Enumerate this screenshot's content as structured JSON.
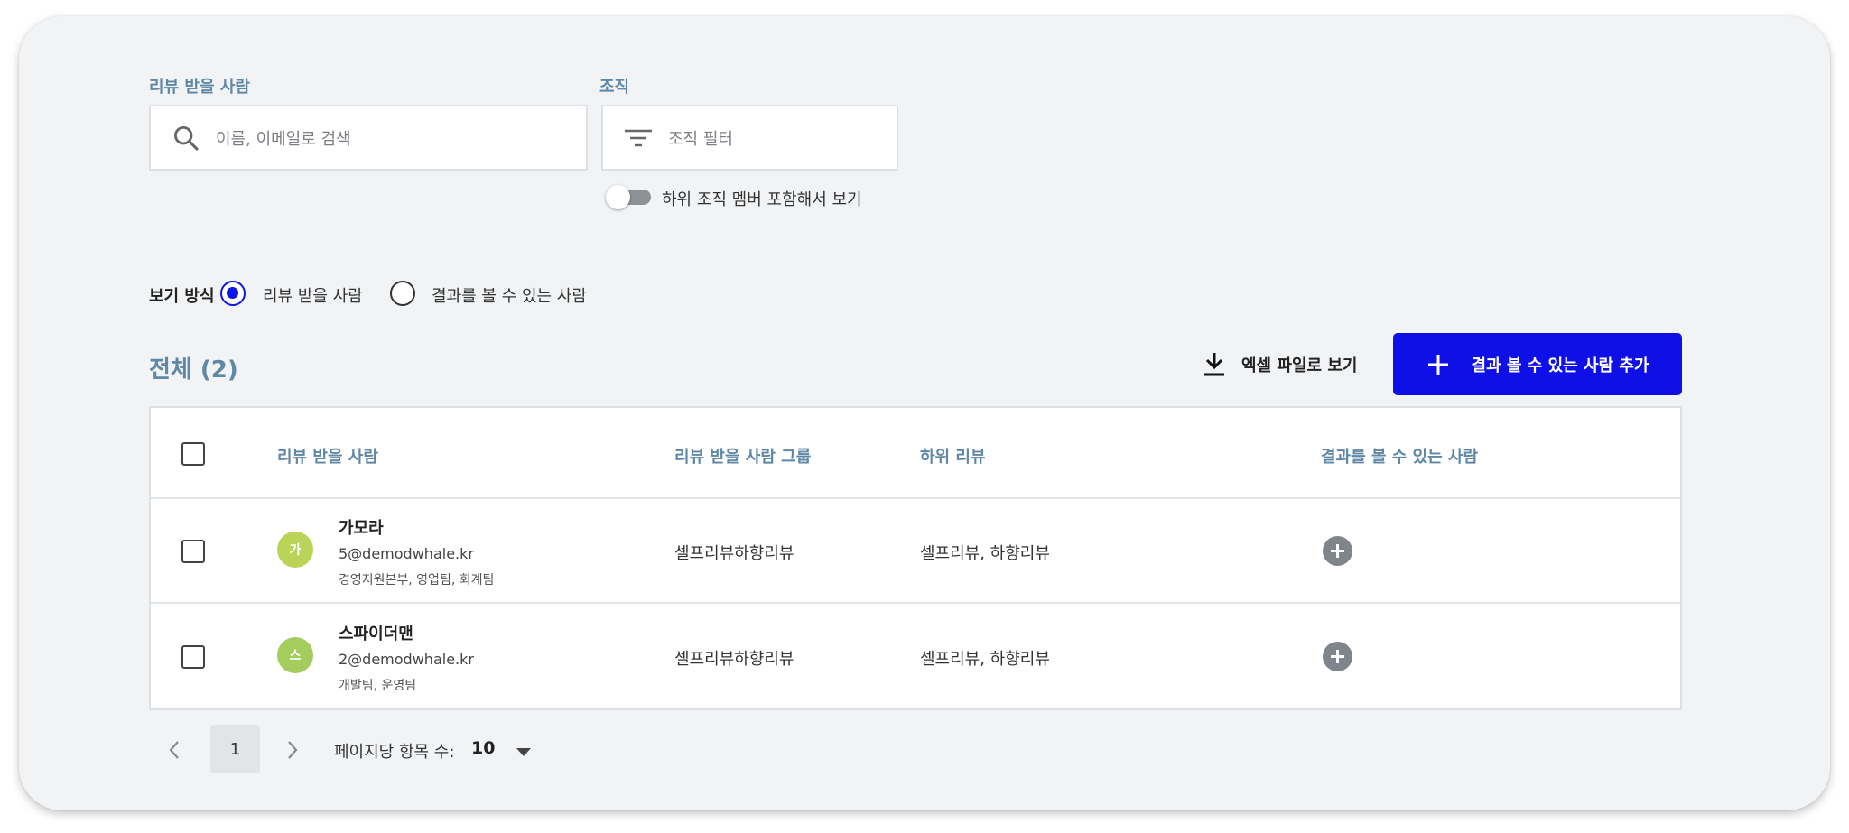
{
  "filters": {
    "reviewee_label": "리뷰 받을 사람",
    "search_placeholder": "이름, 이메일로 검색",
    "org_label": "조직",
    "org_filter_placeholder": "조직 필터",
    "include_sub_toggle_label": "하위 조직 멤버 포함해서 보기",
    "include_sub_toggle_on": false
  },
  "view_mode": {
    "label": "보기 방식",
    "options": [
      {
        "label": "리뷰 받을 사람",
        "selected": true
      },
      {
        "label": "결과를 볼 수 있는 사람",
        "selected": false
      }
    ]
  },
  "toolbar": {
    "total_label": "전체 (2)",
    "excel_label": "엑셀 파일로 보기",
    "add_label": "결과 볼 수 있는 사람 추가"
  },
  "table": {
    "headers": [
      "리뷰 받을 사람",
      "리뷰 받을 사람 그룹",
      "하위 리뷰",
      "결과를 볼 수 있는 사람"
    ],
    "rows": [
      {
        "avatar_initial": "가",
        "avatar_color": "#bcd35a",
        "name": "가모라",
        "email": "5@demodwhale.kr",
        "org": "경영지원본부, 영업팀, 회계팀",
        "group": "셀프리뷰하향리뷰",
        "sub_review": "셀프리뷰, 하향리뷰"
      },
      {
        "avatar_initial": "스",
        "avatar_color": "#a4cd5e",
        "name": "스파이더맨",
        "email": "2@demodwhale.kr",
        "org": "개발팀, 운영팀",
        "group": "셀프리뷰하향리뷰",
        "sub_review": "셀프리뷰, 하향리뷰"
      }
    ]
  },
  "pagination": {
    "current_page": "1",
    "per_page_label": "페이지당 항목 수:",
    "per_page_value": "10"
  },
  "colors": {
    "primary": "#0f0fe8",
    "label_blue": "#5f87a6",
    "card_bg": "#f1f3f5"
  }
}
